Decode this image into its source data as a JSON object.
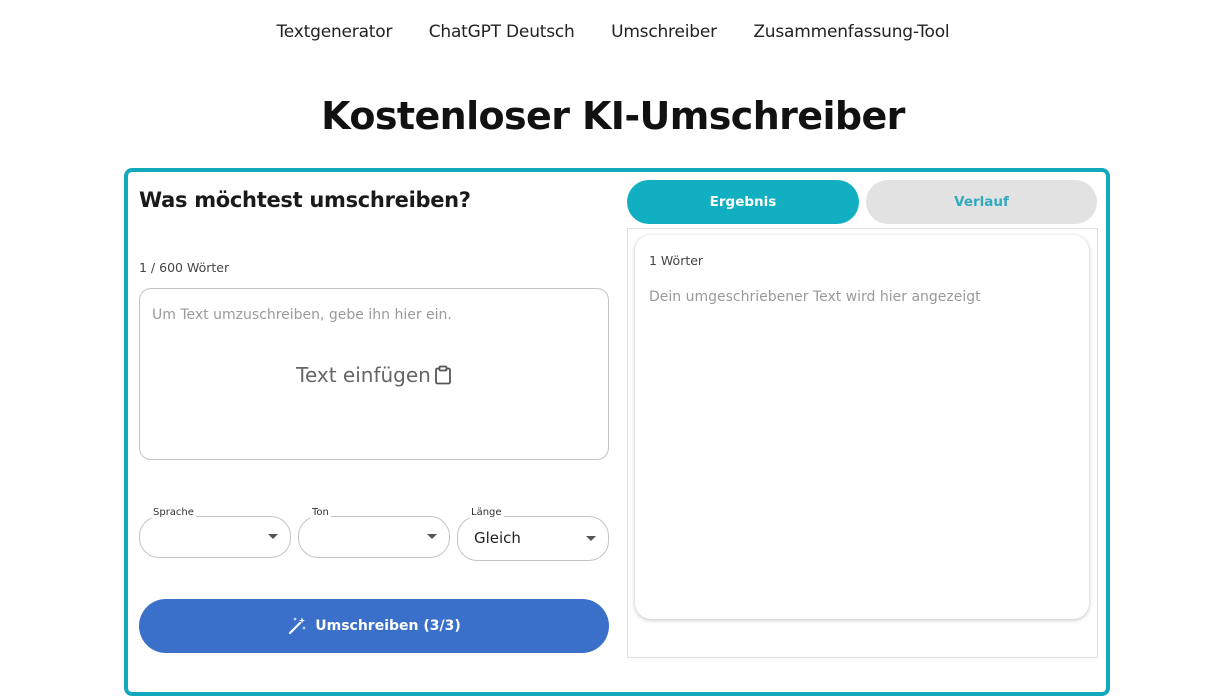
{
  "nav": {
    "items": [
      "Textgenerator",
      "ChatGPT Deutsch",
      "Umschreiber",
      "Zusammenfassung-Tool"
    ]
  },
  "page": {
    "title": "Kostenloser KI-Umschreiber"
  },
  "input_panel": {
    "heading": "Was möchtest umschreiben?",
    "word_count": "1 / 600 Wörter",
    "placeholder": "Um Text umzuschreiben, gebe ihn hier ein.",
    "paste_label": "Text einfügen",
    "paste_icon": "clipboard-icon"
  },
  "options": {
    "language": {
      "label": "Sprache",
      "value": ""
    },
    "tone": {
      "label": "Ton",
      "value": ""
    },
    "length": {
      "label": "Länge",
      "value": "Gleich"
    }
  },
  "submit": {
    "label": "Umschreiben (3/3)",
    "icon": "magic-wand-icon",
    "color": "#3a70c9"
  },
  "output_panel": {
    "tabs": [
      "Ergebnis",
      "Verlauf"
    ],
    "active_tab": "Ergebnis",
    "word_count": "1 Wörter",
    "placeholder": "Dein umgeschriebener Text wird hier angezeigt"
  },
  "colors": {
    "accent": "#12a9bc",
    "tab_inactive_bg": "#e2e2e2",
    "primary_button": "#3a70c9"
  }
}
